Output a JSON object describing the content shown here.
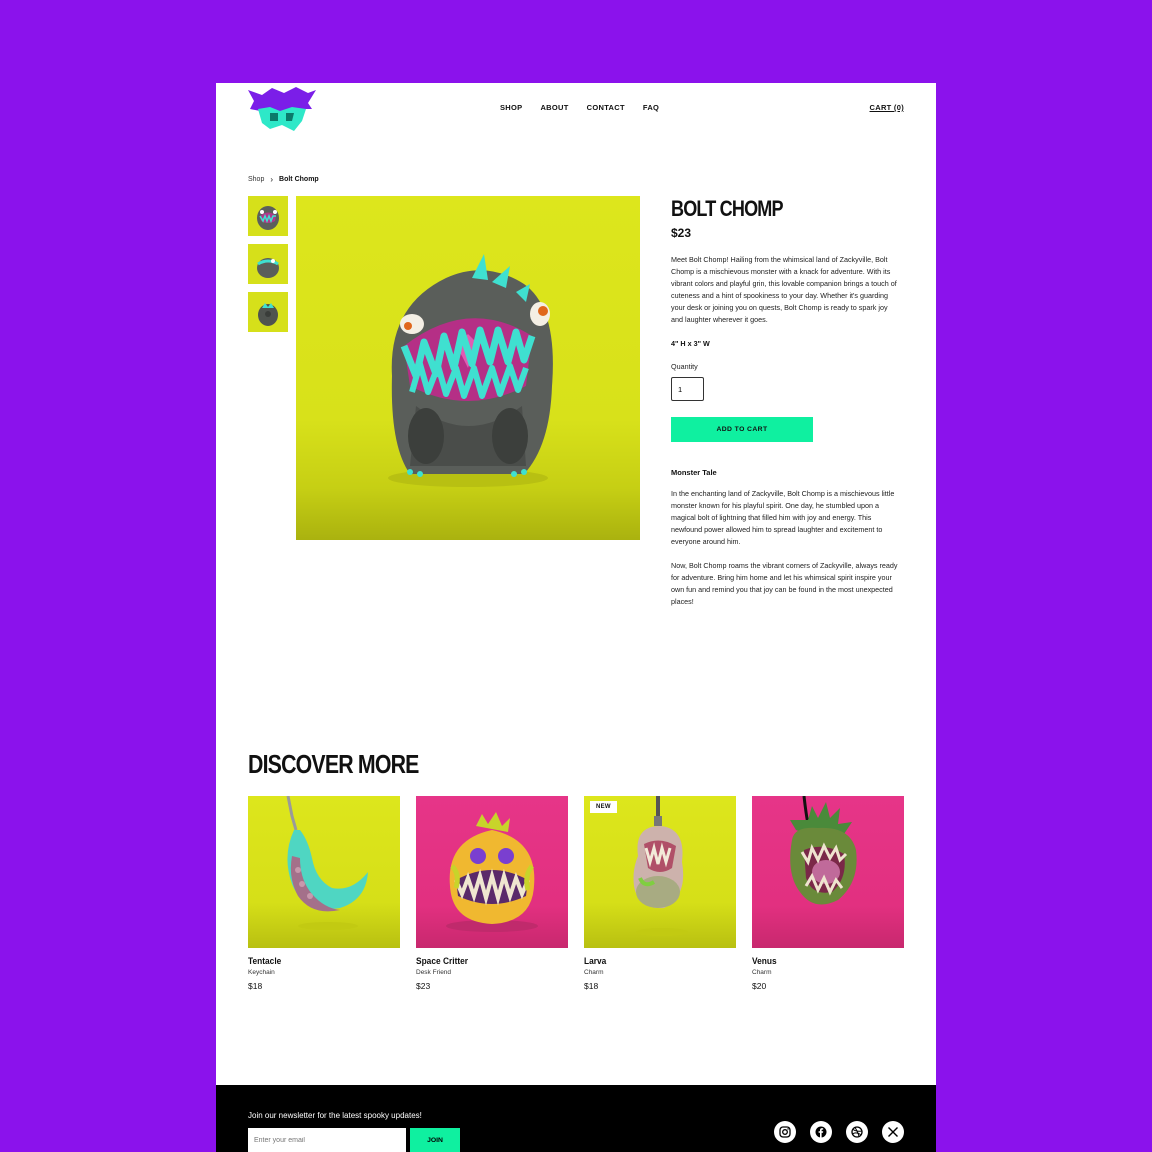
{
  "header": {
    "nav": [
      "SHOP",
      "ABOUT",
      "CONTACT",
      "FAQ"
    ],
    "cart": "CART (0)"
  },
  "breadcrumb": {
    "root": "Shop",
    "separator": "›",
    "current": "Bolt Chomp"
  },
  "product": {
    "title": "BOLT CHOMP",
    "price": "$23",
    "description": "Meet Bolt Chomp! Hailing from the whimsical land of Zackyville, Bolt Chomp is a mischievous monster with a knack for adventure. With its vibrant colors and playful grin, this lovable companion brings a touch of cuteness and a hint of spookiness to your day. Whether it's guarding your desk or joining you on quests, Bolt Chomp is ready to spark joy and laughter wherever it goes.",
    "size": "4\" H x 3\" W",
    "quantity_label": "Quantity",
    "quantity_value": "1",
    "add_to_cart": "ADD TO CART",
    "tale_title": "Monster Tale",
    "tale_p1": "In the enchanting land of Zackyville, Bolt Chomp is a mischievous little monster known for his playful spirit. One day, he stumbled upon a magical bolt of lightning that filled him with joy and energy. This newfound power allowed him to spread laughter and excitement to everyone around him.",
    "tale_p2": "Now, Bolt Chomp roams the vibrant corners of Zackyville, always ready for adventure. Bring him home and let his whimsical spirit inspire your own fun and remind you that joy can be found in the most unexpected places!"
  },
  "discover": {
    "title": "DISCOVER MORE",
    "items": [
      {
        "name": "Tentacle",
        "type": "Keychain",
        "price": "$18"
      },
      {
        "name": "Space Critter",
        "type": "Desk Friend",
        "price": "$23"
      },
      {
        "name": "Larva",
        "type": "Charm",
        "price": "$18",
        "badge": "NEW"
      },
      {
        "name": "Venus",
        "type": "Charm",
        "price": "$20"
      }
    ]
  },
  "footer": {
    "newsletter": "Join our newsletter for the latest spooky updates!",
    "email_placeholder": "Enter your email",
    "join": "JOIN"
  },
  "colors": {
    "background": "#8b12ec",
    "accent": "#0ff0a0",
    "lime": "#dde61c",
    "pink": "#e63588"
  },
  "icons": [
    "instagram-icon",
    "facebook-icon",
    "dribbble-icon",
    "x-icon"
  ]
}
